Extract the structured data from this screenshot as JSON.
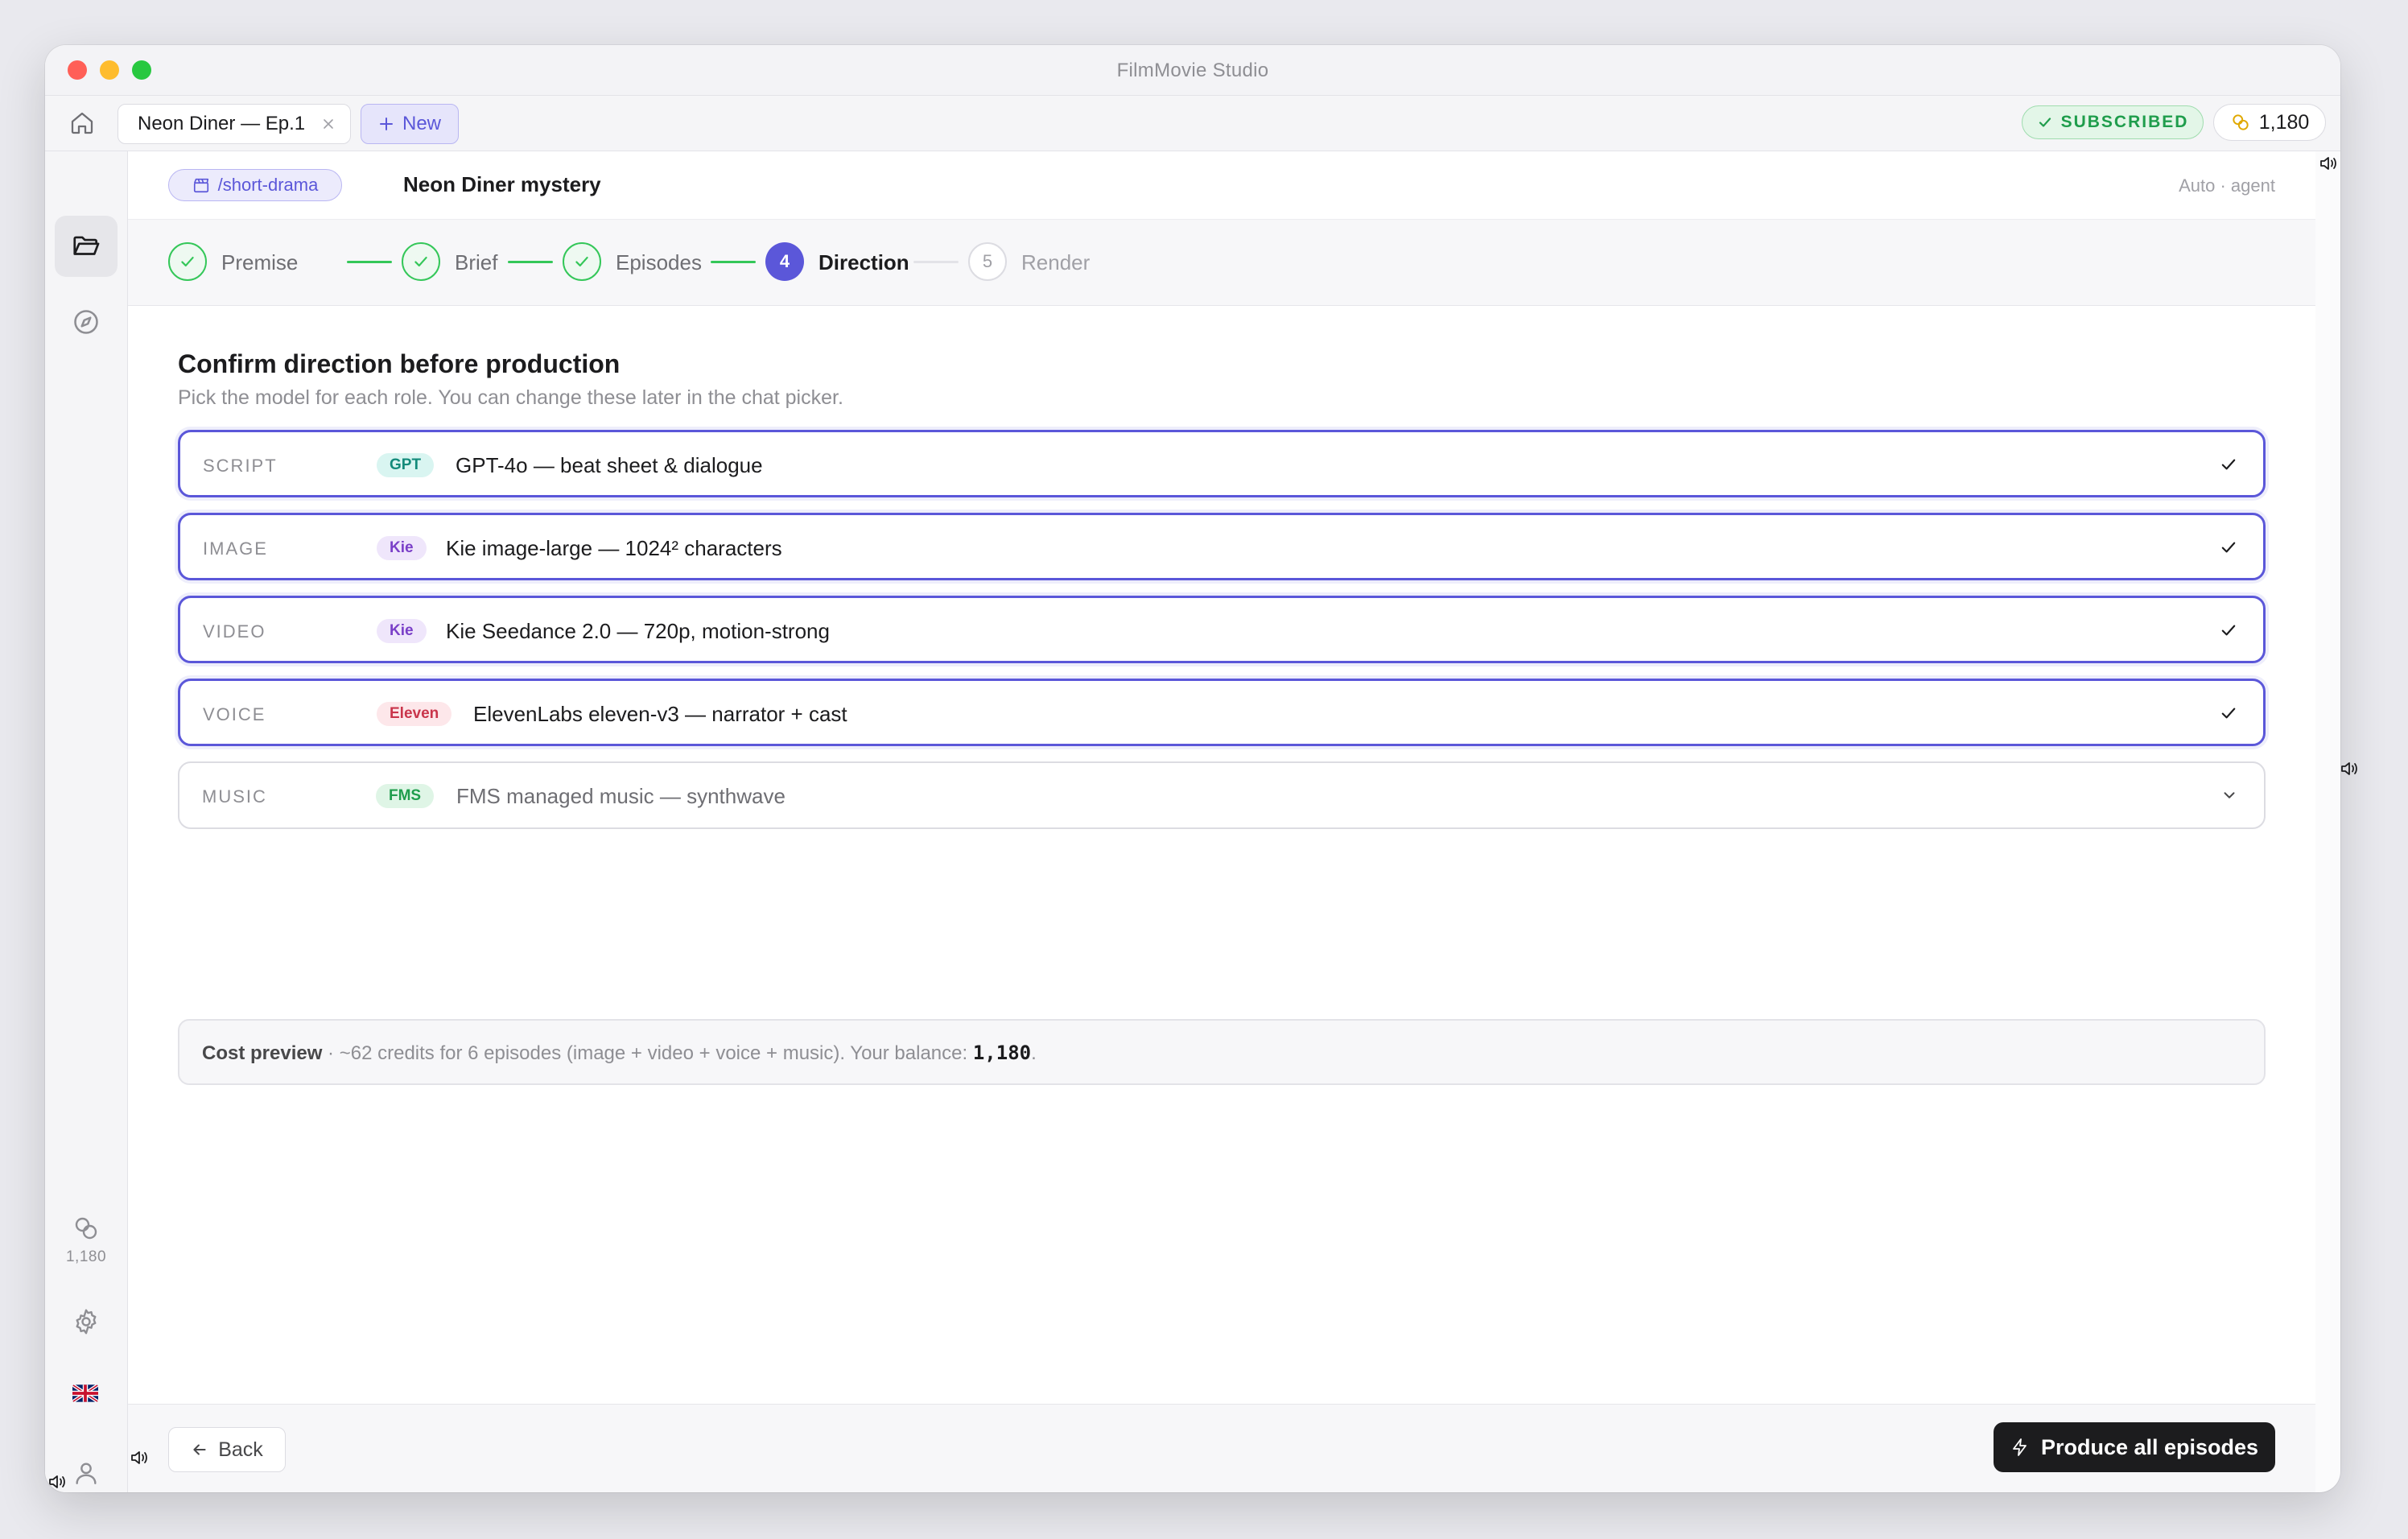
{
  "window": {
    "title": "FilmMovie Studio"
  },
  "tabbar": {
    "active_tab": "Neon Diner — Ep.1",
    "new_tab_label": "New",
    "subscription_badge": "SUBSCRIBED",
    "credits": "1,180"
  },
  "sidebar": {
    "credits": "1,180"
  },
  "header": {
    "command": "/short-drama",
    "project_title": "Neon Diner mystery",
    "mode": "Auto · agent"
  },
  "steps": [
    {
      "label": "Premise",
      "status": "done",
      "number": "1"
    },
    {
      "label": "Brief",
      "status": "done",
      "number": "2"
    },
    {
      "label": "Episodes",
      "status": "done",
      "number": "3"
    },
    {
      "label": "Direction",
      "status": "current",
      "number": "4"
    },
    {
      "label": "Render",
      "status": "pending",
      "number": "5"
    }
  ],
  "content": {
    "title": "Confirm direction before production",
    "subtitle": "Pick the model for each role. You can change these later in the chat picker.",
    "roles": [
      {
        "role": "SCRIPT",
        "provider": "GPT",
        "model": "GPT-4o — beat sheet & dialogue",
        "selected": true
      },
      {
        "role": "IMAGE",
        "provider": "Kie",
        "model": "Kie image-large — 1024² characters",
        "selected": true
      },
      {
        "role": "VIDEO",
        "provider": "Kie",
        "model": "Kie Seedance 2.0 — 720p, motion-strong",
        "selected": true
      },
      {
        "role": "VOICE",
        "provider": "Eleven",
        "model": "ElevenLabs eleven-v3 — narrator + cast",
        "selected": true
      },
      {
        "role": "MUSIC",
        "provider": "FMS",
        "model": "FMS managed music — synthwave",
        "selected": false
      }
    ],
    "cost": {
      "label": "Cost preview",
      "text": " · ~62 credits for 6 episodes (image + video + voice + music). Your balance: ",
      "balance": "1,180",
      "end": "."
    }
  },
  "footer": {
    "back_label": "Back",
    "produce_label": "Produce all episodes"
  },
  "colors": {
    "accent": "#5b57d9",
    "success": "#34c759",
    "primary_button": "#1c1c1e",
    "badge_gpt_bg": "#d9f5f1",
    "badge_gpt_fg": "#138a7a",
    "badge_kie_bg": "#efe6fb",
    "badge_kie_fg": "#7a3fc8",
    "badge_eleven_bg": "#fde7ea",
    "badge_eleven_fg": "#c9354b",
    "badge_fms_bg": "#dff5e6",
    "badge_fms_fg": "#1f9d4c"
  },
  "icons": {
    "home": "home-icon",
    "close": "close-icon",
    "plus": "plus-icon",
    "check": "check-icon",
    "coins": "coins-icon",
    "folder": "folder-open-icon",
    "compass": "compass-icon",
    "gear": "gear-icon",
    "user": "user-icon",
    "flag": "uk-flag-icon",
    "film": "clapperboard-icon",
    "chevron": "chevron-down-icon",
    "arrow": "arrow-left-icon",
    "bolt": "lightning-icon",
    "speaker": "speaker-icon"
  }
}
